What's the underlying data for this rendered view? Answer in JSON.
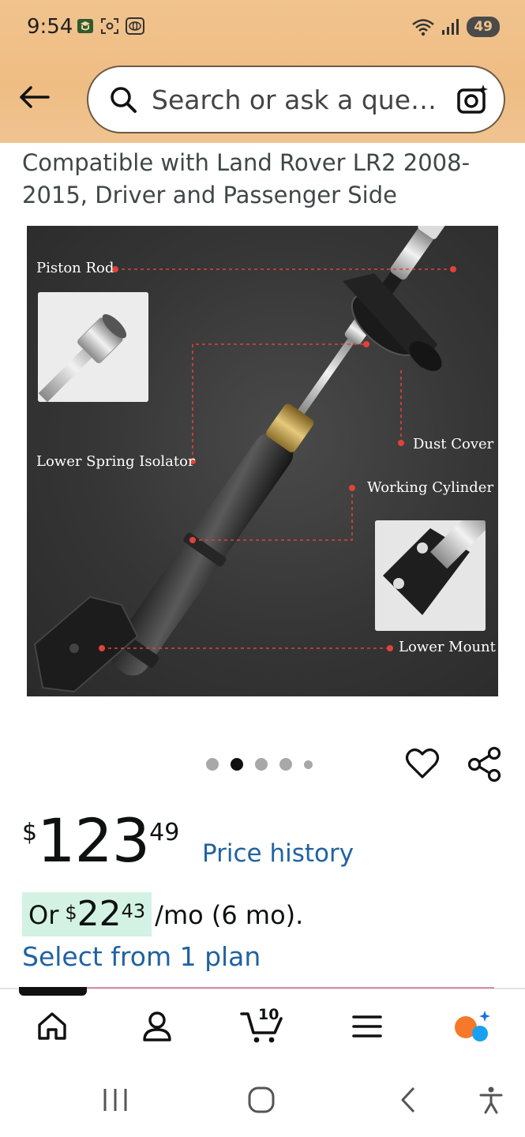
{
  "status_bar": {
    "time": "9:54",
    "battery": "49",
    "icons": [
      "app-icon",
      "scan-icon",
      "toyota-icon"
    ],
    "right_icons": [
      "wifi-icon",
      "signal-icon"
    ]
  },
  "header": {
    "search_placeholder": "Search or ask a que…",
    "icons": [
      "back-arrow-icon",
      "search-icon",
      "camera-search-icon"
    ]
  },
  "product": {
    "title": "Compatible with Land Rover LR2 2008-2015, Driver and Passenger Side",
    "image_labels": {
      "piston_rod": "Piston Rod",
      "lower_spring_isolator": "Lower Spring Isolator",
      "dust_cover": "Dust Cover",
      "working_cylinder": "Working Cylinder",
      "lower_mount": "Lower Mount"
    },
    "carousel": {
      "count": 5,
      "active_index": 1
    }
  },
  "price": {
    "currency": "$",
    "whole": "123",
    "fraction": "49",
    "history_link": "Price history"
  },
  "installment": {
    "prefix": "Or",
    "currency": "$",
    "whole": "22",
    "fraction": "43",
    "suffix": "/mo (6 mo).",
    "plan_link": "Select from 1 plan"
  },
  "bottom_nav": {
    "cart_count": "10",
    "items": [
      "home-icon",
      "account-icon",
      "cart-icon",
      "menu-icon",
      "rufus-icon"
    ]
  },
  "system_nav": [
    "recents-icon",
    "home-circle-icon",
    "back-icon",
    "accessibility-icon"
  ],
  "colors": {
    "header_bg": "#f1c38d",
    "link": "#2162a1",
    "installment_bg": "#d3f2e3",
    "callout": "#e0423a"
  }
}
